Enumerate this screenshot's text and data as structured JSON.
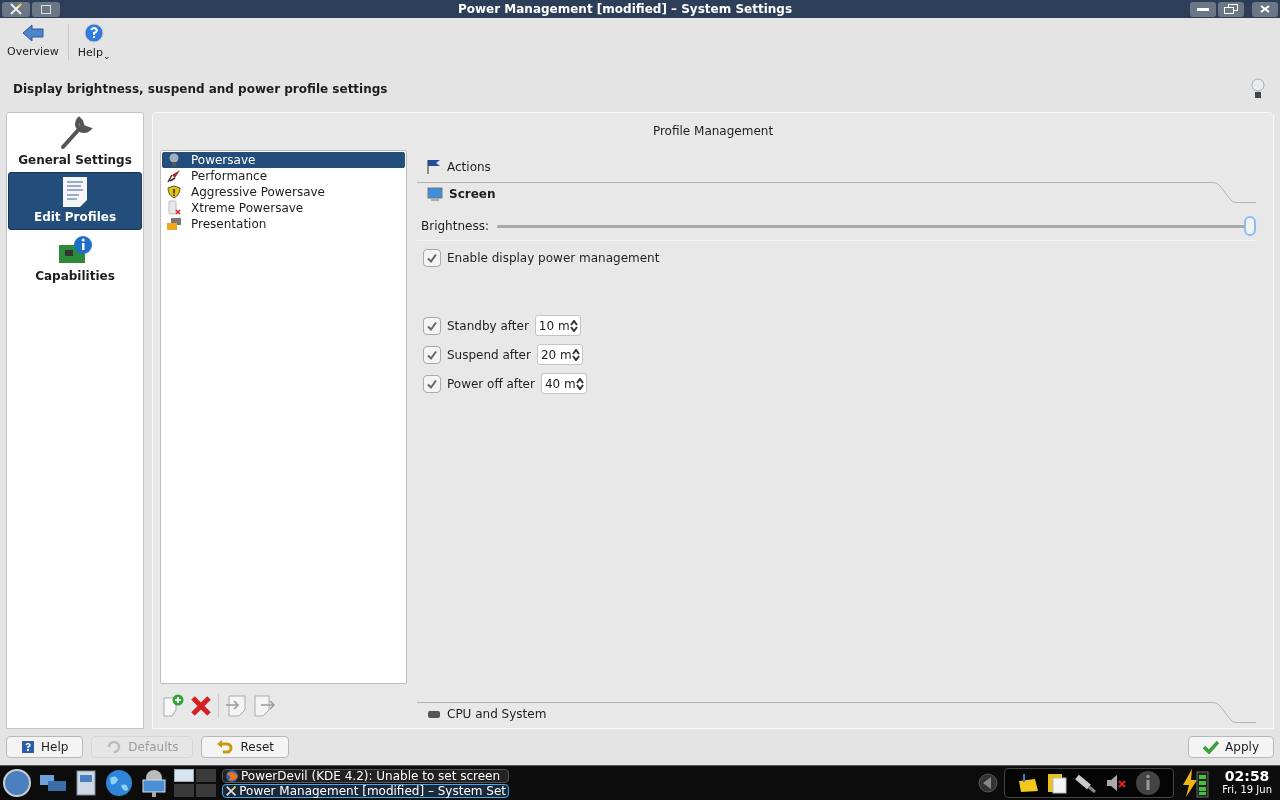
{
  "window": {
    "title": "Power Management [modified] – System Settings"
  },
  "toolbar": [
    {
      "label": "Overview",
      "kind": "back"
    },
    {
      "label": "Help",
      "kind": "help",
      "caret": "⌄"
    }
  ],
  "description": "Display brightness, suspend and power profile settings",
  "sidebar": {
    "items": [
      {
        "label": "General Settings",
        "kind": "wrench",
        "selected": false
      },
      {
        "label": "Edit Profiles",
        "kind": "document",
        "selected": true
      },
      {
        "label": "Capabilities",
        "kind": "card",
        "selected": false
      }
    ]
  },
  "panel_title": "Profile Management",
  "profiles": [
    {
      "label": "Powersave",
      "kind": "bulb",
      "selected": true
    },
    {
      "label": "Performance",
      "kind": "rocket",
      "selected": false
    },
    {
      "label": "Aggressive Powersave",
      "kind": "shield",
      "selected": false
    },
    {
      "label": "Xtreme Powersave",
      "kind": "battery",
      "selected": false
    },
    {
      "label": "Presentation",
      "kind": "screen",
      "selected": false
    }
  ],
  "sections": {
    "actions": "Actions",
    "screen": "Screen",
    "cpu": "CPU and System"
  },
  "brightness": {
    "label": "Brightness:",
    "level": 1.0
  },
  "enable_dpm": {
    "label": "Enable display power management",
    "checked": true
  },
  "timeouts": [
    {
      "label": "Standby after",
      "value": "10 m",
      "checked": true
    },
    {
      "label": "Suspend after",
      "value": "20 m",
      "checked": true
    },
    {
      "label": "Power off after",
      "value": "40 m",
      "checked": true
    }
  ],
  "buttons": [
    {
      "label": "Help",
      "kind": "help",
      "disabled": false
    },
    {
      "label": "Defaults",
      "kind": "defaults",
      "disabled": true
    },
    {
      "label": "Reset",
      "kind": "reset",
      "disabled": false
    },
    {
      "label": "Apply",
      "kind": "apply",
      "disabled": false
    }
  ],
  "taskbar": {
    "pager": [
      {
        "selected": true
      },
      {
        "selected": false
      },
      {
        "selected": false
      },
      {
        "selected": false
      }
    ],
    "tasks": [
      {
        "label": "PowerDevil (KDE 4.2): Unable to set screen",
        "kind": "browser",
        "selected": false
      },
      {
        "label": "Power Management [modified] – System Set",
        "kind": "settings",
        "selected": true
      }
    ],
    "time": "02:58",
    "date": "Fri, 19 Jun"
  }
}
